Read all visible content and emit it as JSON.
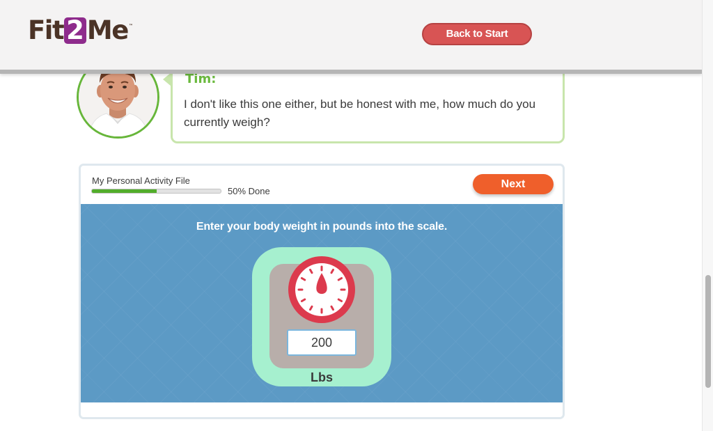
{
  "header": {
    "logo": {
      "part1": "Fit",
      "part2": "2",
      "part3": "Me",
      "trademark": "™"
    },
    "back_button": "Back to Start"
  },
  "chat": {
    "speaker": "Tim:",
    "message": "I don't like this one either, but be honest with me, how much do you currently weigh?"
  },
  "activity": {
    "file_title": "My Personal Activity File",
    "progress_fraction": 0.5,
    "progress_text": "50% Done",
    "next_button": "Next",
    "instruction": "Enter your body weight in pounds into the scale.",
    "weight_value": "200",
    "unit": "Lbs"
  },
  "colors": {
    "brand_purple": "#8e2b8c",
    "back_button": "#d85454",
    "next_button": "#ef5f2b",
    "progress_green": "#52ad2b",
    "panel_blue": "#5c9ac5",
    "scale_mint": "#a6f0cf",
    "dial_red": "#dc3a4d",
    "speaker_green": "#6ab93d"
  },
  "icons": {
    "avatar": "person-photo",
    "dial": "scale-dial-icon"
  }
}
